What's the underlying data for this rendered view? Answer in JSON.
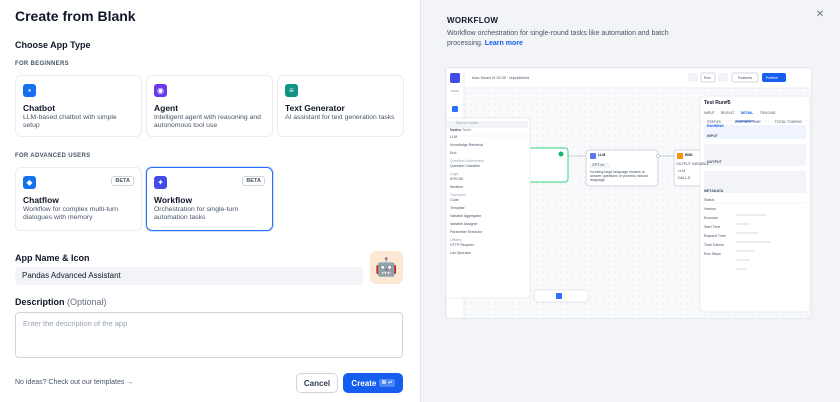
{
  "dialog": {
    "title": "Create from Blank",
    "close_icon": "close-icon"
  },
  "app_type": {
    "heading": "Choose App Type",
    "beginners_label": "FOR BEGINNERS",
    "advanced_label": "FOR ADVANCED USERS",
    "cards": [
      {
        "name": "Chatbot",
        "desc": "LLM-based chatbot with simple setup",
        "icon": "chatbot-icon",
        "color": "#1570ef"
      },
      {
        "name": "Agent",
        "desc": "Intelligent agent with reasoning and autonomous tool use",
        "icon": "agent-icon",
        "color": "#6938ef"
      },
      {
        "name": "Text Generator",
        "desc": "AI assistant for text generation tasks",
        "icon": "text-generator-icon",
        "color": "#0e9384"
      },
      {
        "name": "Chatflow",
        "desc": "Workflow for complex multi-turn dialogues with memory",
        "icon": "chatflow-icon",
        "color": "#1570ef",
        "badge": "BETA"
      },
      {
        "name": "Workflow",
        "desc": "Orchestration for single-turn automation tasks",
        "icon": "workflow-icon",
        "color": "#444ce7",
        "badge": "BETA",
        "selected": true
      }
    ]
  },
  "app_name": {
    "label": "App Name & Icon",
    "value": "Pandas Advanced Assistant",
    "avatar_icon": "robot-icon"
  },
  "description": {
    "label": "Description",
    "optional": "(Optional)",
    "placeholder": "Enter the description of the app"
  },
  "footer": {
    "ideas": "No ideas? Check out our templates",
    "cancel": "Cancel",
    "create": "Create",
    "shortcut": "⌘ ↵"
  },
  "preview": {
    "heading": "WORKFLOW",
    "desc": "Workflow orchestration for single-round tasks like automation and batch processing.",
    "learn_more": "Learn more",
    "topbar": {
      "title": "Auto-Saved 21:02:35 · Unpublished",
      "run": "Run",
      "features": "Features",
      "publish": "Publish"
    },
    "node_panel": {
      "search": "Search nodes...",
      "tabs": [
        "Nodes",
        "Tools"
      ],
      "items_top": [
        "LLM",
        "Knowledge Retrieval",
        "End"
      ],
      "group_qu": "Question Understand",
      "items_qu": [
        "Question Classifier"
      ],
      "group_logic": "Logic",
      "items_logic": [
        "IF/ELSE",
        "Iteration"
      ],
      "group_transform": "Transform",
      "items_transform": [
        "Code",
        "Template",
        "Variable Aggregator",
        "Variable Assigner",
        "Parameter Extractor"
      ],
      "group_utilities": "Utilities",
      "items_utilities": [
        "HTTP Request",
        "List Operator"
      ]
    },
    "llm_node": {
      "title": "LLM",
      "model": "GPT-4o",
      "desc": "Invoking large language models to answer questions or process natural language"
    },
    "end_node": {
      "title": "END",
      "l1": "OUTPUT VARIABLE",
      "l2": "LLM",
      "l3": "DALL-E"
    },
    "run_panel": {
      "title": "Test Run#5",
      "tabs": [
        "INPUT",
        "RESULT",
        "DETAIL",
        "TRACING"
      ],
      "status_label": "STATUS",
      "status": "RUNNING",
      "elapsed": "ELAPSED TIME",
      "tokens": "TOTAL TOKENS",
      "input": "INPUT",
      "output": "OUTPUT",
      "metadata": "METADATA",
      "meta_rows": [
        "Status",
        "Version",
        "Executor",
        "Start Time",
        "Elapsed Time",
        "Total Tokens",
        "Run Steps"
      ]
    }
  }
}
